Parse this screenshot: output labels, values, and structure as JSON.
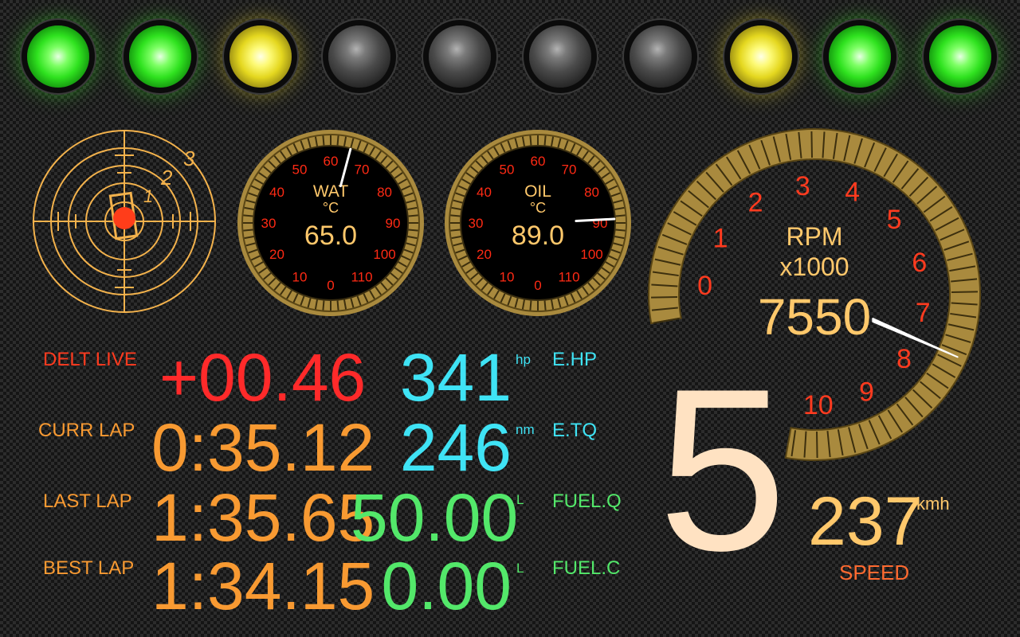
{
  "leds": [
    {
      "name": "led-1",
      "color": "green"
    },
    {
      "name": "led-2",
      "color": "green"
    },
    {
      "name": "led-3",
      "color": "yellow"
    },
    {
      "name": "led-4",
      "color": "off"
    },
    {
      "name": "led-5",
      "color": "off"
    },
    {
      "name": "led-6",
      "color": "off"
    },
    {
      "name": "led-7",
      "color": "off"
    },
    {
      "name": "led-8",
      "color": "yellow"
    },
    {
      "name": "led-9",
      "color": "green"
    },
    {
      "name": "led-10",
      "color": "green"
    }
  ],
  "sector_map": {
    "ring_labels": [
      "1",
      "2",
      "3"
    ]
  },
  "water_gauge": {
    "title": "WAT",
    "unit": "°C",
    "value": "65.0",
    "needle_value": 65,
    "ticks": [
      "0",
      "10",
      "20",
      "30",
      "40",
      "50",
      "60",
      "70",
      "80",
      "90",
      "100",
      "110"
    ]
  },
  "oil_gauge": {
    "title": "OIL",
    "unit": "°C",
    "value": "89.0",
    "needle_value": 89,
    "ticks": [
      "0",
      "10",
      "20",
      "30",
      "40",
      "50",
      "60",
      "70",
      "80",
      "90",
      "100",
      "110"
    ]
  },
  "rpm_gauge": {
    "title": "RPM",
    "multiplier": "x1000",
    "value": "7550",
    "needle_value": 7.55,
    "ticks": [
      "0",
      "1",
      "2",
      "3",
      "4",
      "5",
      "6",
      "7",
      "8",
      "9",
      "10"
    ]
  },
  "timing": {
    "delta_label": "DELT LIVE",
    "delta_value": "+00.46",
    "current_lap_label": "CURR LAP",
    "current_lap_value": "0:35.12",
    "last_lap_label": "LAST LAP",
    "last_lap_value": "1:35.65",
    "best_lap_label": "BEST LAP",
    "best_lap_value": "1:34.15"
  },
  "engine": {
    "hp_value": "341",
    "hp_unit": "hp",
    "hp_label": "E.HP",
    "torque_value": "246",
    "torque_unit": "nm",
    "torque_label": "E.TQ"
  },
  "fuel": {
    "quantity_value": "50.00",
    "quantity_unit": "L",
    "quantity_label": "FUEL.Q",
    "consumption_value": "0.00",
    "consumption_unit": "L",
    "consumption_label": "FUEL.C"
  },
  "gear": "5",
  "speed": {
    "value": "237",
    "unit": "kmh",
    "label": "SPEED"
  },
  "colors": {
    "led_green": "#3fff2a",
    "led_yellow": "#fff23a",
    "gauge_gold": "#b89a4e",
    "tick_red": "#ff2a14",
    "value_orange": "#f89a32",
    "value_cyan": "#3fe3f5",
    "value_green": "#53e86a"
  }
}
